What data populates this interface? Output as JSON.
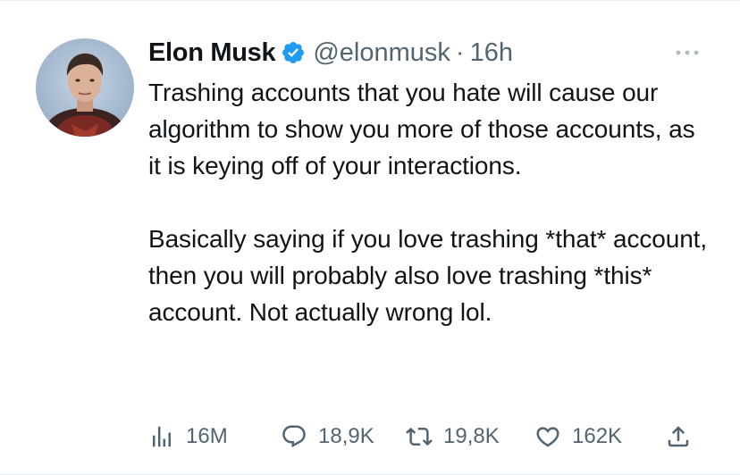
{
  "tweet": {
    "author": {
      "name": "Elon Musk",
      "handle": "@elonmusk",
      "verified": true,
      "avatar": "profile-photo"
    },
    "separator": "·",
    "time": "16h",
    "text": "Trashing accounts that you hate will cause our algorithm to show you more of those accounts, as it is keying off of your interactions.\n\nBasically saying if you love trashing *that* account, then you will probably also love trashing *this* account. Not actually wrong lol.",
    "stats": {
      "views": "16M",
      "replies": "18,9K",
      "retweets": "19,8K",
      "likes": "162K"
    }
  },
  "icons": {
    "more": "more-horizontal-icon",
    "views": "analytics-bar-icon",
    "reply": "reply-bubble-icon",
    "retweet": "retweet-icon",
    "like": "heart-icon",
    "share": "share-upload-icon",
    "verified": "verified-badge-icon"
  },
  "colors": {
    "text": "#0f1419",
    "secondary": "#536471",
    "verified_blue": "#1d9bf0",
    "border": "#e6ecf0"
  }
}
